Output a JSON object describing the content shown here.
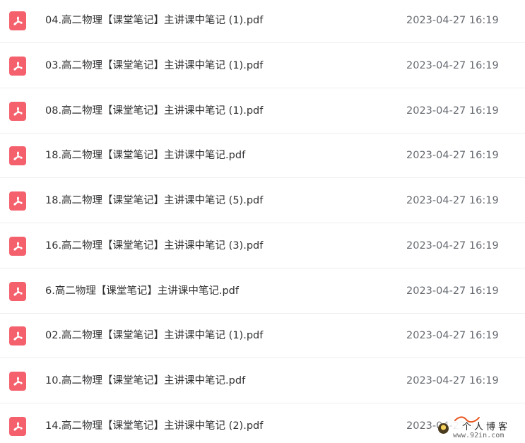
{
  "colors": {
    "pdf_icon": "#f4606c",
    "name_text": "#303133",
    "date_text": "#666a70",
    "divider": "#efefef"
  },
  "files": [
    {
      "name": "04.高二物理【课堂笔记】主讲课中笔记 (1).pdf",
      "date": "2023-04-27 16:19",
      "icon": "pdf-icon"
    },
    {
      "name": "03.高二物理【课堂笔记】主讲课中笔记 (1).pdf",
      "date": "2023-04-27 16:19",
      "icon": "pdf-icon"
    },
    {
      "name": "08.高二物理【课堂笔记】主讲课中笔记 (1).pdf",
      "date": "2023-04-27 16:19",
      "icon": "pdf-icon"
    },
    {
      "name": "18.高二物理【课堂笔记】主讲课中笔记.pdf",
      "date": "2023-04-27 16:19",
      "icon": "pdf-icon"
    },
    {
      "name": "18.高二物理【课堂笔记】主讲课中笔记 (5).pdf",
      "date": "2023-04-27 16:19",
      "icon": "pdf-icon"
    },
    {
      "name": "16.高二物理【课堂笔记】主讲课中笔记 (3).pdf",
      "date": "2023-04-27 16:19",
      "icon": "pdf-icon"
    },
    {
      "name": "6.高二物理【课堂笔记】主讲课中笔记.pdf",
      "date": "2023-04-27 16:19",
      "icon": "pdf-icon"
    },
    {
      "name": "02.高二物理【课堂笔记】主讲课中笔记 (1).pdf",
      "date": "2023-04-27 16:19",
      "icon": "pdf-icon"
    },
    {
      "name": "10.高二物理【课堂笔记】主讲课中笔记.pdf",
      "date": "2023-04-27 16:19",
      "icon": "pdf-icon"
    },
    {
      "name": "14.高二物理【课堂笔记】主讲课中笔记 (2).pdf",
      "date": "2023-04-27 16:19",
      "icon": "pdf-icon"
    }
  ],
  "watermark": {
    "title": "个人博客",
    "url": "www.92in.com"
  }
}
